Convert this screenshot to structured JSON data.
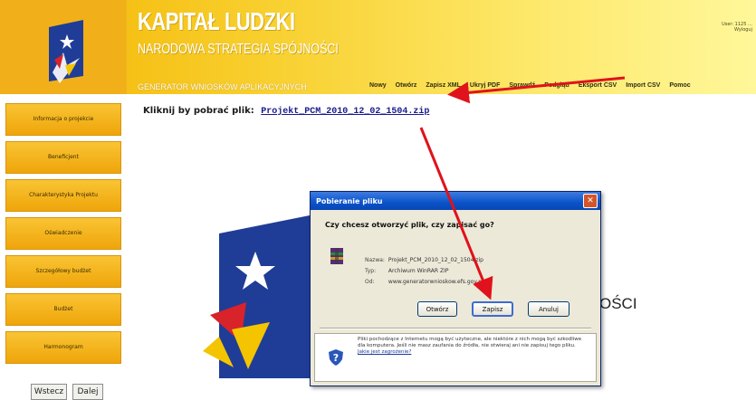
{
  "header": {
    "title": "KAPITAŁ LUDZKI",
    "subtitle": "NARODOWA STRATEGIA SPÓJNOŚCI",
    "generator": "GENERATOR WNIOSKÓW APLIKACYJNYCH",
    "user_info": "User: 1125 … Wyloguj"
  },
  "menu": [
    "Nowy",
    "Otwórz",
    "Zapisz XML",
    "Ukryj PDF",
    "Sprawdź",
    "Podgląd",
    "Eksport CSV",
    "Import CSV",
    "Pomoc"
  ],
  "sidebar": [
    "Informacja o projekcie",
    "Beneficjent",
    "Charakterystyka Projektu",
    "Oświadczenie",
    "Szczegółowy budżet",
    "Budżet",
    "Harmonogram"
  ],
  "nav": {
    "back": "Wstecz",
    "next": "Dalej"
  },
  "download": {
    "prompt": "Kliknij by pobrać plik:",
    "file_link": "Projekt_PCM_2010_12_02_1504.zip"
  },
  "background_text": "OŚCI",
  "dialog": {
    "title": "Pobieranie pliku",
    "question": "Czy chcesz otworzyć plik, czy zapisać go?",
    "name_label": "Nazwa:",
    "name_value": "Projekt_PCM_2010_12_02_1504.zip",
    "type_label": "Typ:",
    "type_value": "Archiwum WinRAR ZIP",
    "from_label": "Od:",
    "from_value": "www.generatorwnioskow.efs.gov.pl",
    "buttons": {
      "open": "Otwórz",
      "save": "Zapisz",
      "cancel": "Anuluj"
    },
    "warning": "Pliki pochodzące z Internetu mogą być użyteczne, ale niektóre z nich mogą być szkodliwe dla komputera. Jeśli nie masz zaufania do źródła, nie otwieraj ani nie zapisuj tego pliku.",
    "warning_link": "Jakie jest zagrożenie?"
  },
  "colors": {
    "header_start": "#f4b400",
    "header_end": "#fff79a",
    "sidebar_button": "#f1b019",
    "annotation_arrow": "#e0121b",
    "titlebar": "#0a53c9"
  }
}
